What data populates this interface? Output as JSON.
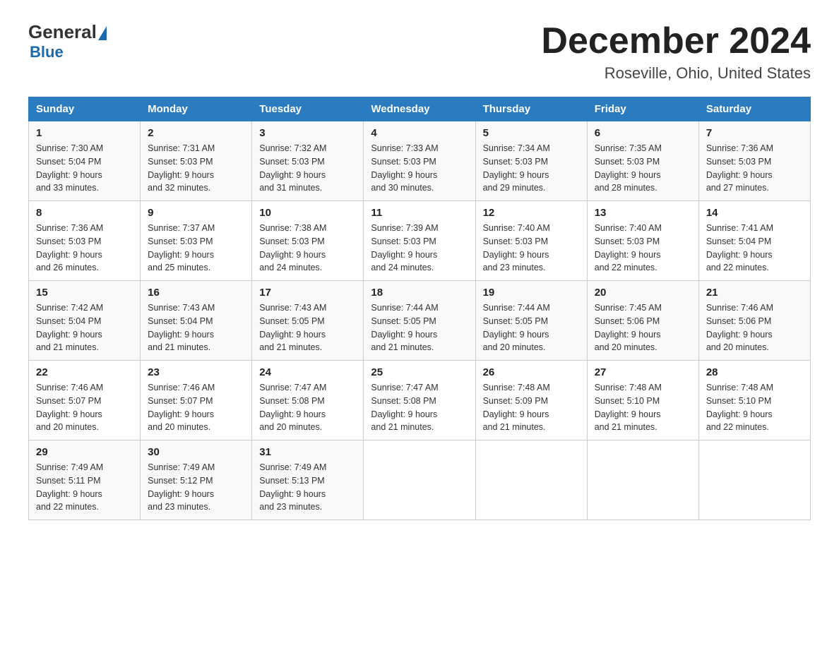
{
  "header": {
    "logo_general": "General",
    "logo_blue": "Blue",
    "month_title": "December 2024",
    "location": "Roseville, Ohio, United States"
  },
  "days_of_week": [
    "Sunday",
    "Monday",
    "Tuesday",
    "Wednesday",
    "Thursday",
    "Friday",
    "Saturday"
  ],
  "weeks": [
    [
      {
        "day": "1",
        "sunrise": "7:30 AM",
        "sunset": "5:04 PM",
        "daylight": "9 hours and 33 minutes."
      },
      {
        "day": "2",
        "sunrise": "7:31 AM",
        "sunset": "5:03 PM",
        "daylight": "9 hours and 32 minutes."
      },
      {
        "day": "3",
        "sunrise": "7:32 AM",
        "sunset": "5:03 PM",
        "daylight": "9 hours and 31 minutes."
      },
      {
        "day": "4",
        "sunrise": "7:33 AM",
        "sunset": "5:03 PM",
        "daylight": "9 hours and 30 minutes."
      },
      {
        "day": "5",
        "sunrise": "7:34 AM",
        "sunset": "5:03 PM",
        "daylight": "9 hours and 29 minutes."
      },
      {
        "day": "6",
        "sunrise": "7:35 AM",
        "sunset": "5:03 PM",
        "daylight": "9 hours and 28 minutes."
      },
      {
        "day": "7",
        "sunrise": "7:36 AM",
        "sunset": "5:03 PM",
        "daylight": "9 hours and 27 minutes."
      }
    ],
    [
      {
        "day": "8",
        "sunrise": "7:36 AM",
        "sunset": "5:03 PM",
        "daylight": "9 hours and 26 minutes."
      },
      {
        "day": "9",
        "sunrise": "7:37 AM",
        "sunset": "5:03 PM",
        "daylight": "9 hours and 25 minutes."
      },
      {
        "day": "10",
        "sunrise": "7:38 AM",
        "sunset": "5:03 PM",
        "daylight": "9 hours and 24 minutes."
      },
      {
        "day": "11",
        "sunrise": "7:39 AM",
        "sunset": "5:03 PM",
        "daylight": "9 hours and 24 minutes."
      },
      {
        "day": "12",
        "sunrise": "7:40 AM",
        "sunset": "5:03 PM",
        "daylight": "9 hours and 23 minutes."
      },
      {
        "day": "13",
        "sunrise": "7:40 AM",
        "sunset": "5:03 PM",
        "daylight": "9 hours and 22 minutes."
      },
      {
        "day": "14",
        "sunrise": "7:41 AM",
        "sunset": "5:04 PM",
        "daylight": "9 hours and 22 minutes."
      }
    ],
    [
      {
        "day": "15",
        "sunrise": "7:42 AM",
        "sunset": "5:04 PM",
        "daylight": "9 hours and 21 minutes."
      },
      {
        "day": "16",
        "sunrise": "7:43 AM",
        "sunset": "5:04 PM",
        "daylight": "9 hours and 21 minutes."
      },
      {
        "day": "17",
        "sunrise": "7:43 AM",
        "sunset": "5:05 PM",
        "daylight": "9 hours and 21 minutes."
      },
      {
        "day": "18",
        "sunrise": "7:44 AM",
        "sunset": "5:05 PM",
        "daylight": "9 hours and 21 minutes."
      },
      {
        "day": "19",
        "sunrise": "7:44 AM",
        "sunset": "5:05 PM",
        "daylight": "9 hours and 20 minutes."
      },
      {
        "day": "20",
        "sunrise": "7:45 AM",
        "sunset": "5:06 PM",
        "daylight": "9 hours and 20 minutes."
      },
      {
        "day": "21",
        "sunrise": "7:46 AM",
        "sunset": "5:06 PM",
        "daylight": "9 hours and 20 minutes."
      }
    ],
    [
      {
        "day": "22",
        "sunrise": "7:46 AM",
        "sunset": "5:07 PM",
        "daylight": "9 hours and 20 minutes."
      },
      {
        "day": "23",
        "sunrise": "7:46 AM",
        "sunset": "5:07 PM",
        "daylight": "9 hours and 20 minutes."
      },
      {
        "day": "24",
        "sunrise": "7:47 AM",
        "sunset": "5:08 PM",
        "daylight": "9 hours and 20 minutes."
      },
      {
        "day": "25",
        "sunrise": "7:47 AM",
        "sunset": "5:08 PM",
        "daylight": "9 hours and 21 minutes."
      },
      {
        "day": "26",
        "sunrise": "7:48 AM",
        "sunset": "5:09 PM",
        "daylight": "9 hours and 21 minutes."
      },
      {
        "day": "27",
        "sunrise": "7:48 AM",
        "sunset": "5:10 PM",
        "daylight": "9 hours and 21 minutes."
      },
      {
        "day": "28",
        "sunrise": "7:48 AM",
        "sunset": "5:10 PM",
        "daylight": "9 hours and 22 minutes."
      }
    ],
    [
      {
        "day": "29",
        "sunrise": "7:49 AM",
        "sunset": "5:11 PM",
        "daylight": "9 hours and 22 minutes."
      },
      {
        "day": "30",
        "sunrise": "7:49 AM",
        "sunset": "5:12 PM",
        "daylight": "9 hours and 23 minutes."
      },
      {
        "day": "31",
        "sunrise": "7:49 AM",
        "sunset": "5:13 PM",
        "daylight": "9 hours and 23 minutes."
      },
      null,
      null,
      null,
      null
    ]
  ],
  "labels": {
    "sunrise": "Sunrise:",
    "sunset": "Sunset:",
    "daylight": "Daylight:"
  }
}
